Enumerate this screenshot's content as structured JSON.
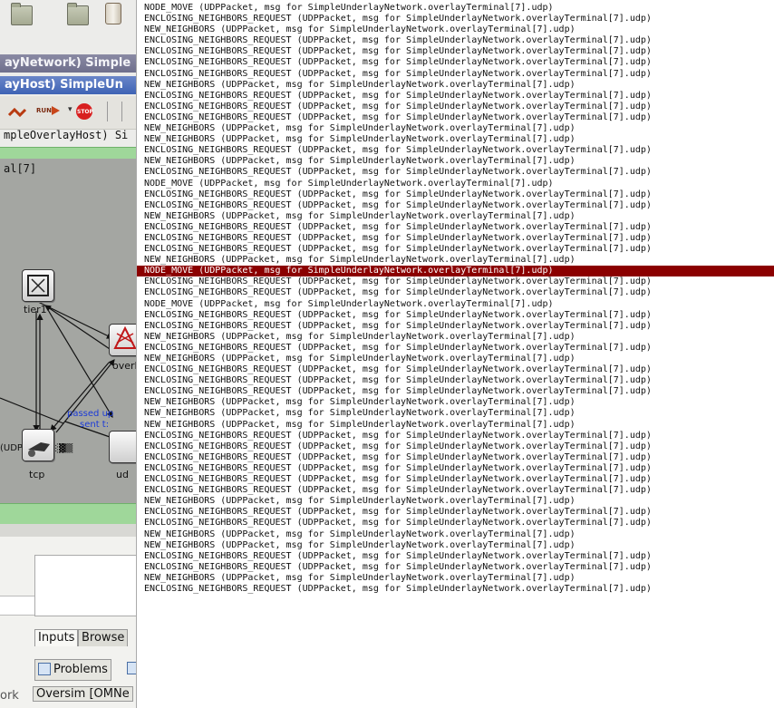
{
  "left_window": {
    "title_network": "ayNetwork) Simple",
    "title_host": "ayHost) SimpleUn",
    "path_text": "mpleOverlayHost) Si",
    "module_label": "al[7]",
    "run_labels": [
      "RUN",
      "STOP"
    ],
    "nodes": {
      "tier1": "tier1",
      "overlay": "overl",
      "tcp": "tcp",
      "udp": "ud"
    },
    "overlay_text": "(UDPack▓▒░▓▒",
    "msg_label_1": "passed up",
    "msg_label_2": "sent t:",
    "tabs": {
      "inputs": "Inputs",
      "browse": "Browse",
      "problems": "Problems"
    },
    "status_left": "ork",
    "status_app": "Oversim [OMNe"
  },
  "log": {
    "selected_index": 24,
    "colors": {
      "selected_bg": "#8b0000",
      "selected_fg": "#ffffff"
    },
    "lines": [
      "NODE_MOVE (UDPPacket, msg for SimpleUnderlayNetwork.overlayTerminal[7].udp)",
      "ENCLOSING_NEIGHBORS_REQUEST (UDPPacket, msg for SimpleUnderlayNetwork.overlayTerminal[7].udp)",
      "NEW_NEIGHBORS (UDPPacket, msg for SimpleUnderlayNetwork.overlayTerminal[7].udp)",
      "ENCLOSING_NEIGHBORS_REQUEST (UDPPacket, msg for SimpleUnderlayNetwork.overlayTerminal[7].udp)",
      "ENCLOSING_NEIGHBORS_REQUEST (UDPPacket, msg for SimpleUnderlayNetwork.overlayTerminal[7].udp)",
      "ENCLOSING_NEIGHBORS_REQUEST (UDPPacket, msg for SimpleUnderlayNetwork.overlayTerminal[7].udp)",
      "ENCLOSING_NEIGHBORS_REQUEST (UDPPacket, msg for SimpleUnderlayNetwork.overlayTerminal[7].udp)",
      "NEW_NEIGHBORS (UDPPacket, msg for SimpleUnderlayNetwork.overlayTerminal[7].udp)",
      "ENCLOSING_NEIGHBORS_REQUEST (UDPPacket, msg for SimpleUnderlayNetwork.overlayTerminal[7].udp)",
      "ENCLOSING_NEIGHBORS_REQUEST (UDPPacket, msg for SimpleUnderlayNetwork.overlayTerminal[7].udp)",
      "ENCLOSING_NEIGHBORS_REQUEST (UDPPacket, msg for SimpleUnderlayNetwork.overlayTerminal[7].udp)",
      "NEW_NEIGHBORS (UDPPacket, msg for SimpleUnderlayNetwork.overlayTerminal[7].udp)",
      "NEW_NEIGHBORS (UDPPacket, msg for SimpleUnderlayNetwork.overlayTerminal[7].udp)",
      "ENCLOSING_NEIGHBORS_REQUEST (UDPPacket, msg for SimpleUnderlayNetwork.overlayTerminal[7].udp)",
      "NEW_NEIGHBORS (UDPPacket, msg for SimpleUnderlayNetwork.overlayTerminal[7].udp)",
      "ENCLOSING_NEIGHBORS_REQUEST (UDPPacket, msg for SimpleUnderlayNetwork.overlayTerminal[7].udp)",
      "NODE_MOVE (UDPPacket, msg for SimpleUnderlayNetwork.overlayTerminal[7].udp)",
      "ENCLOSING_NEIGHBORS_REQUEST (UDPPacket, msg for SimpleUnderlayNetwork.overlayTerminal[7].udp)",
      "ENCLOSING_NEIGHBORS_REQUEST (UDPPacket, msg for SimpleUnderlayNetwork.overlayTerminal[7].udp)",
      "NEW_NEIGHBORS (UDPPacket, msg for SimpleUnderlayNetwork.overlayTerminal[7].udp)",
      "ENCLOSING_NEIGHBORS_REQUEST (UDPPacket, msg for SimpleUnderlayNetwork.overlayTerminal[7].udp)",
      "ENCLOSING_NEIGHBORS_REQUEST (UDPPacket, msg for SimpleUnderlayNetwork.overlayTerminal[7].udp)",
      "ENCLOSING_NEIGHBORS_REQUEST (UDPPacket, msg for SimpleUnderlayNetwork.overlayTerminal[7].udp)",
      "NEW_NEIGHBORS (UDPPacket, msg for SimpleUnderlayNetwork.overlayTerminal[7].udp)",
      "NODE_MOVE (UDPPacket, msg for SimpleUnderlayNetwork.overlayTerminal[7].udp)",
      "ENCLOSING_NEIGHBORS_REQUEST (UDPPacket, msg for SimpleUnderlayNetwork.overlayTerminal[7].udp)",
      "ENCLOSING_NEIGHBORS_REQUEST (UDPPacket, msg for SimpleUnderlayNetwork.overlayTerminal[7].udp)",
      "NODE_MOVE (UDPPacket, msg for SimpleUnderlayNetwork.overlayTerminal[7].udp)",
      "ENCLOSING_NEIGHBORS_REQUEST (UDPPacket, msg for SimpleUnderlayNetwork.overlayTerminal[7].udp)",
      "ENCLOSING_NEIGHBORS_REQUEST (UDPPacket, msg for SimpleUnderlayNetwork.overlayTerminal[7].udp)",
      "NEW_NEIGHBORS (UDPPacket, msg for SimpleUnderlayNetwork.overlayTerminal[7].udp)",
      "ENCLOSING_NEIGHBORS_REQUEST (UDPPacket, msg for SimpleUnderlayNetwork.overlayTerminal[7].udp)",
      "NEW_NEIGHBORS (UDPPacket, msg for SimpleUnderlayNetwork.overlayTerminal[7].udp)",
      "ENCLOSING_NEIGHBORS_REQUEST (UDPPacket, msg for SimpleUnderlayNetwork.overlayTerminal[7].udp)",
      "ENCLOSING_NEIGHBORS_REQUEST (UDPPacket, msg for SimpleUnderlayNetwork.overlayTerminal[7].udp)",
      "ENCLOSING_NEIGHBORS_REQUEST (UDPPacket, msg for SimpleUnderlayNetwork.overlayTerminal[7].udp)",
      "NEW_NEIGHBORS (UDPPacket, msg for SimpleUnderlayNetwork.overlayTerminal[7].udp)",
      "NEW_NEIGHBORS (UDPPacket, msg for SimpleUnderlayNetwork.overlayTerminal[7].udp)",
      "NEW_NEIGHBORS (UDPPacket, msg for SimpleUnderlayNetwork.overlayTerminal[7].udp)",
      "ENCLOSING_NEIGHBORS_REQUEST (UDPPacket, msg for SimpleUnderlayNetwork.overlayTerminal[7].udp)",
      "ENCLOSING_NEIGHBORS_REQUEST (UDPPacket, msg for SimpleUnderlayNetwork.overlayTerminal[7].udp)",
      "ENCLOSING_NEIGHBORS_REQUEST (UDPPacket, msg for SimpleUnderlayNetwork.overlayTerminal[7].udp)",
      "ENCLOSING_NEIGHBORS_REQUEST (UDPPacket, msg for SimpleUnderlayNetwork.overlayTerminal[7].udp)",
      "ENCLOSING_NEIGHBORS_REQUEST (UDPPacket, msg for SimpleUnderlayNetwork.overlayTerminal[7].udp)",
      "ENCLOSING_NEIGHBORS_REQUEST (UDPPacket, msg for SimpleUnderlayNetwork.overlayTerminal[7].udp)",
      "NEW_NEIGHBORS (UDPPacket, msg for SimpleUnderlayNetwork.overlayTerminal[7].udp)",
      "ENCLOSING_NEIGHBORS_REQUEST (UDPPacket, msg for SimpleUnderlayNetwork.overlayTerminal[7].udp)",
      "ENCLOSING_NEIGHBORS_REQUEST (UDPPacket, msg for SimpleUnderlayNetwork.overlayTerminal[7].udp)",
      "NEW_NEIGHBORS (UDPPacket, msg for SimpleUnderlayNetwork.overlayTerminal[7].udp)",
      "NEW_NEIGHBORS (UDPPacket, msg for SimpleUnderlayNetwork.overlayTerminal[7].udp)",
      "ENCLOSING_NEIGHBORS_REQUEST (UDPPacket, msg for SimpleUnderlayNetwork.overlayTerminal[7].udp)",
      "ENCLOSING_NEIGHBORS_REQUEST (UDPPacket, msg for SimpleUnderlayNetwork.overlayTerminal[7].udp)",
      "NEW_NEIGHBORS (UDPPacket, msg for SimpleUnderlayNetwork.overlayTerminal[7].udp)",
      "ENCLOSING_NEIGHBORS_REQUEST (UDPPacket, msg for SimpleUnderlayNetwork.overlayTerminal[7].udp)"
    ]
  }
}
